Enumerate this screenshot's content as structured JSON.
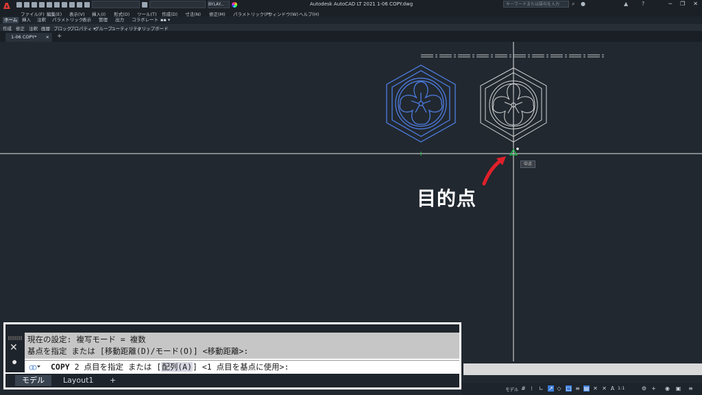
{
  "app": {
    "title": "Autodesk AutoCAD LT 2021    1-06 COPY.dwg",
    "logo": "A",
    "search_placeholder": "キーワードまたは語句を入力",
    "layer_dropdown": "BYLAY...",
    "window_buttons": [
      "─",
      "❐",
      "✕"
    ]
  },
  "menu": {
    "items": [
      "ファイル(F)",
      "編集(E)",
      "表示(V)",
      "挿入(I)",
      "形式(O)",
      "ツール(T)",
      "作成(D)",
      "寸法(N)",
      "修正(M)",
      "パラメトリック(P)",
      "ウィンドウ(W)",
      "ヘルプ(H)"
    ]
  },
  "ribbon": {
    "tabs": [
      "ホーム",
      "挿入",
      "注釈",
      "パラメトリック",
      "表示",
      "管理",
      "出力",
      "コラボレート",
      "▪▪ ▾"
    ],
    "panels": [
      "作成",
      "修正",
      "注釈",
      "画層",
      "ブロック",
      "プロパティ ▾",
      "グループ",
      "ユーティリティ",
      "クリップボード"
    ]
  },
  "doc_tab": {
    "label": "1-06 COPY*",
    "close": "×",
    "add": "+"
  },
  "canvas": {
    "annotation": "目的点",
    "snap_tooltip": "中点"
  },
  "command": {
    "history_line1": "現在の設定:  複写モード = 複数",
    "history_line2": "基点を指定 または [移動距離(D)/モード(O)] <移動距離>:",
    "prompt_cmd": "COPY",
    "prompt_text1": " 2 点目を指定 または [",
    "prompt_opt": "配列(A)",
    "prompt_text2": "] <1 点目を基点に使用>:",
    "close_glyph": "✕",
    "wrench_glyph": "🔧"
  },
  "layout_tabs": {
    "model": "モデル",
    "layout1": "Layout1",
    "add": "+"
  },
  "status": {
    "model_label": "モデル",
    "scale": "1:1"
  },
  "colors": {
    "canvas_bg": "#212830",
    "selected_blue": "#4b78d6",
    "copy_white": "#d6d6d6",
    "snap_green": "#22c24a",
    "arrow_red": "#e0202a"
  }
}
